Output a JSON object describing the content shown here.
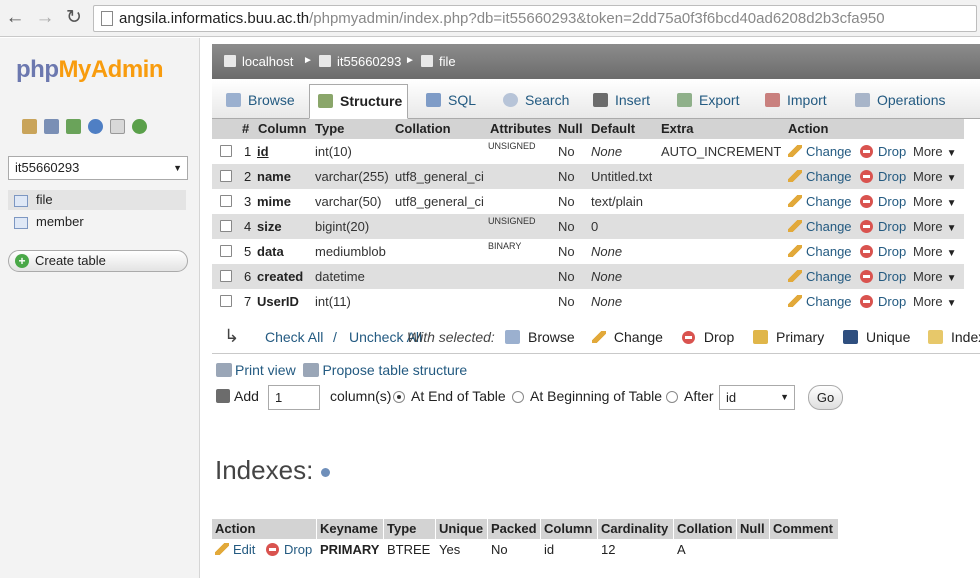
{
  "browser": {
    "url_host": "angsila.informatics.buu.ac.th",
    "url_rest": "/phpmyadmin/index.php?db=it55660293&token=2dd75a0f3f6bcd40ad6208d2b3cfa950"
  },
  "sidebar": {
    "logo_php": "php",
    "logo_myadmin": "MyAdmin",
    "database": "it55660293",
    "tables": [
      "file",
      "member"
    ],
    "create_table": "Create table"
  },
  "breadcrumb": {
    "server": "localhost",
    "database": "it55660293",
    "table": "file"
  },
  "tabs": [
    "Browse",
    "Structure",
    "SQL",
    "Search",
    "Insert",
    "Export",
    "Import",
    "Operations"
  ],
  "structure": {
    "headers": [
      "#",
      "Column",
      "Type",
      "Collation",
      "Attributes",
      "Null",
      "Default",
      "Extra",
      "Action"
    ],
    "rows": [
      {
        "num": "1",
        "name": "id",
        "type": "int(10)",
        "collation": "",
        "attributes": "UNSIGNED",
        "null": "No",
        "default": "None",
        "extra": "AUTO_INCREMENT"
      },
      {
        "num": "2",
        "name": "name",
        "type": "varchar(255)",
        "collation": "utf8_general_ci",
        "attributes": "",
        "null": "No",
        "default": "Untitled.txt",
        "extra": ""
      },
      {
        "num": "3",
        "name": "mime",
        "type": "varchar(50)",
        "collation": "utf8_general_ci",
        "attributes": "",
        "null": "No",
        "default": "text/plain",
        "extra": ""
      },
      {
        "num": "4",
        "name": "size",
        "type": "bigint(20)",
        "collation": "",
        "attributes": "UNSIGNED",
        "null": "No",
        "default": "0",
        "extra": ""
      },
      {
        "num": "5",
        "name": "data",
        "type": "mediumblob",
        "collation": "",
        "attributes": "BINARY",
        "null": "No",
        "default": "None",
        "extra": ""
      },
      {
        "num": "6",
        "name": "created",
        "type": "datetime",
        "collation": "",
        "attributes": "",
        "null": "No",
        "default": "None",
        "extra": ""
      },
      {
        "num": "7",
        "name": "UserID",
        "type": "int(11)",
        "collation": "",
        "attributes": "",
        "null": "No",
        "default": "None",
        "extra": ""
      }
    ],
    "action_change": "Change",
    "action_drop": "Drop",
    "action_more": "More"
  },
  "with_selected": {
    "check_all": "Check All",
    "separator": " / ",
    "uncheck_all": "Uncheck All",
    "label": "With selected:",
    "actions": [
      "Browse",
      "Change",
      "Drop",
      "Primary",
      "Unique",
      "Index"
    ]
  },
  "tools": {
    "print_view": "Print view",
    "propose": "Propose table structure",
    "add_label": "Add",
    "add_count": "1",
    "columns_label": "column(s)",
    "at_end": "At End of Table",
    "at_beginning": "At Beginning of Table",
    "after": "After",
    "after_column": "id",
    "go": "Go"
  },
  "indexes": {
    "title": "Indexes:",
    "headers": [
      "Action",
      "Keyname",
      "Type",
      "Unique",
      "Packed",
      "Column",
      "Cardinality",
      "Collation",
      "Null",
      "Comment"
    ],
    "row": {
      "edit": "Edit",
      "drop": "Drop",
      "keyname": "PRIMARY",
      "type": "BTREE",
      "unique": "Yes",
      "packed": "No",
      "column": "id",
      "cardinality": "12",
      "collation": "A",
      "null": "",
      "comment": ""
    }
  }
}
